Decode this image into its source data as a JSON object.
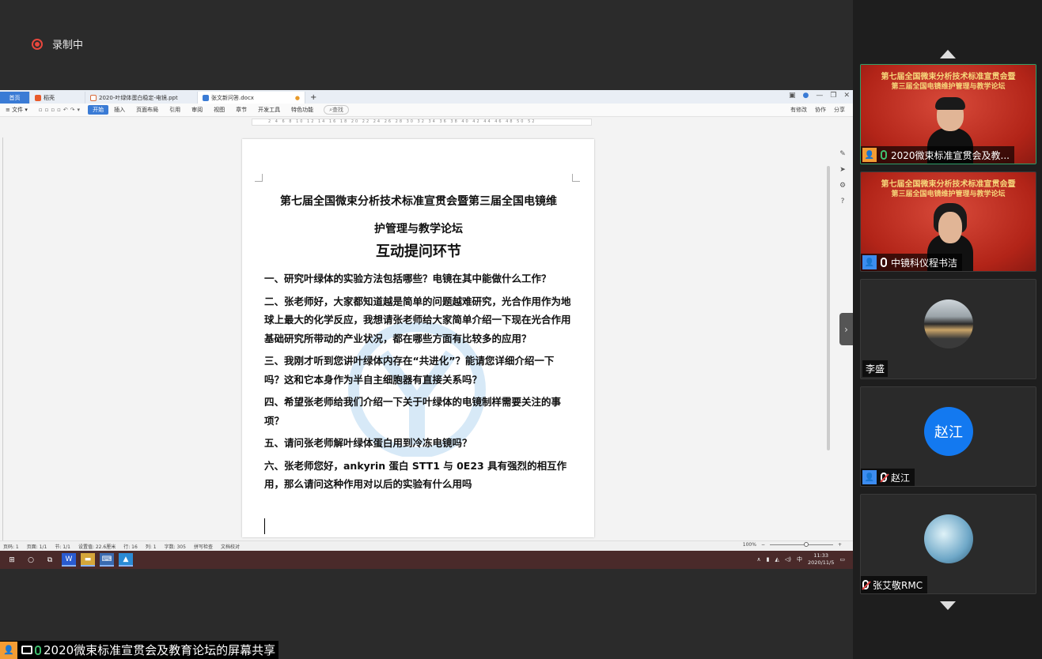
{
  "recording": {
    "label": "录制中"
  },
  "wps": {
    "tabs": [
      {
        "label": "首页"
      },
      {
        "label": "稻壳"
      },
      {
        "label": "2020-叶绿体蛋白稳定-电镜.ppt"
      },
      {
        "label": "张文新问答.docx"
      }
    ],
    "new_tab": "+",
    "menu": [
      "文件",
      "开始",
      "插入",
      "页面布局",
      "引用",
      "审阅",
      "视图",
      "章节",
      "开发工具",
      "特色功能"
    ],
    "search_label": "查找",
    "right_menu": [
      "有修改",
      "协作",
      "分享"
    ],
    "ruler_text": "2 4 6 8 10 12 14 16 18 20 22 24 26 28 30 32 34 36 38 40 42 44 46 48 50 52"
  },
  "document": {
    "title_line1": "第七届全国微束分析技术标准宣贯会暨第三届全国电镜维",
    "title_line2": "护管理与教学论坛",
    "subtitle": "互动提问环节",
    "questions": [
      "一、研究叶绿体的实验方法包括哪些？电镜在其中能做什么工作？",
      "二、张老师好，大家都知道越是简单的问题越难研究，光合作用作为地球上最大的化学反应，我想请张老师给大家简单介绍一下现在光合作用基础研究所带动的产业状况，都在哪些方面有比较多的应用？",
      "三、我刚才听到您讲叶绿体内存在“共进化”？能请您详细介绍一下吗？这和它本身作为半自主细胞器有直接关系吗？",
      "四、希望张老师给我们介绍一下关于叶绿体的电镜制样需要关注的事项？",
      "五、请问张老师解叶绿体蛋白用到冷冻电镜吗？",
      "六、张老师您好，ankyrin 蛋白 STT1 与 0E23 具有强烈的相互作用，那么请问这种作用对以后的实验有什么用吗"
    ]
  },
  "statusbar": {
    "items": [
      "页码: 1",
      "页面: 1/1",
      "节: 1/1",
      "设置值: 22.6厘米",
      "行: 16",
      "列: 1",
      "字数: 305",
      "拼写检查",
      "文档校对"
    ],
    "zoom": "100%",
    "zoom_fraction": 0.58
  },
  "taskbar": {
    "time": "11:33",
    "date": "2020/11/5",
    "ime": "中"
  },
  "participants": [
    {
      "name": "2020微束标准宣贯会及教...",
      "banner1": "第七届全国微束分析技术标准宣贯会暨",
      "banner2": "第三届全国电镜维护管理与教学论坛"
    },
    {
      "name": "中镜科仪程书洁",
      "banner1": "第七届全国微束分析技术标准宣贯会暨",
      "banner2": "第三届全国电镜维护管理与教学论坛"
    },
    {
      "name": "李盛"
    },
    {
      "name": "赵江",
      "initials": "赵江"
    },
    {
      "name": "张艾敬RMC"
    }
  ],
  "caption": {
    "text": "2020微束标准宣贯会及教育论坛的屏幕共享"
  },
  "colors": {
    "accent": "#3a7bd5",
    "record": "#e8473d",
    "active_speaker": "#2f9f6a",
    "avatar_blue": "#1379f0"
  }
}
